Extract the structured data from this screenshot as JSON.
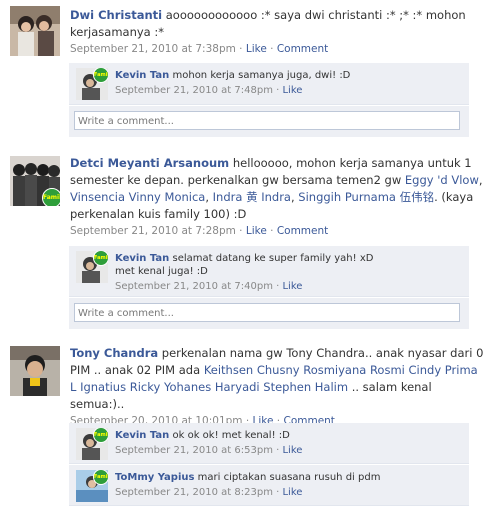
{
  "sep": " · ",
  "posts": [
    {
      "author": "Dwi Christanti",
      "text": " aoooooooooooo :* saya dwi christanti :* ;* :* mohon kerjasamanya :*",
      "time": "September 21, 2010 at 7:38pm",
      "like": "Like",
      "comment": "Comment",
      "replies": [
        {
          "author": "Kevin Tan",
          "text": " mohon kerja samanya juga, dwi! :D",
          "time": "September 21, 2010 at 7:48pm",
          "like": "Like"
        }
      ],
      "write_placeholder": "Write a comment..."
    },
    {
      "author": "Detci Meyanti Arsanoum",
      "text1": " hellooooo, mohon kerja samanya untuk 1 semester ke depan. perkenalkan gw bersama temen2 gw ",
      "tag1": "Eggy 'd Vlow",
      "c1": ", ",
      "tag2": "Vinsencia Vinny Monica",
      "c2": ", ",
      "tag3": "Indra 黄 Indra",
      "c3": ", ",
      "tag4": "Singgih Purnama 伍伟铭",
      "text2": ". (kaya perkenalan kuis family 100) :D",
      "time": "September 21, 2010 at 7:28pm",
      "like": "Like",
      "comment": "Comment",
      "replies": [
        {
          "author": "Kevin Tan",
          "text": " selamat datang ke super family yah! xD",
          "text_line2": "met kenal juga! :D",
          "time": "September 21, 2010 at 7:40pm",
          "like": "Like"
        }
      ],
      "write_placeholder": "Write a comment..."
    },
    {
      "author": "Tony Chandra",
      "text1": " perkenalan nama gw Tony Chandra.. anak nyasar dari 0 PIM .. anak 02 PIM ada ",
      "tag1": "Keithsen Chusny",
      "tag2": "Rosmiyana Rosmi",
      "tag3": "Cindy Prima L",
      "tag4": "Ignatius Ricky Yohanes Haryadi",
      "tag5": "Stephen Halim",
      "text2": " .. salam kenal semua:)..",
      "time": "September 20, 2010 at 10:01pm",
      "like": "Like",
      "comment": "Comment",
      "replies": [
        {
          "author": "Kevin Tan",
          "text": " ok ok ok! met kenal! :D",
          "time": "September 21, 2010 at 6:53pm",
          "like": "Like"
        },
        {
          "author": "ToMmy Yapius",
          "text": " mari ciptakan suasana rusuh di pdm",
          "time": "September 21, 2010 at 8:23pm",
          "like": "Like"
        }
      ]
    }
  ],
  "badge_text": "Family"
}
